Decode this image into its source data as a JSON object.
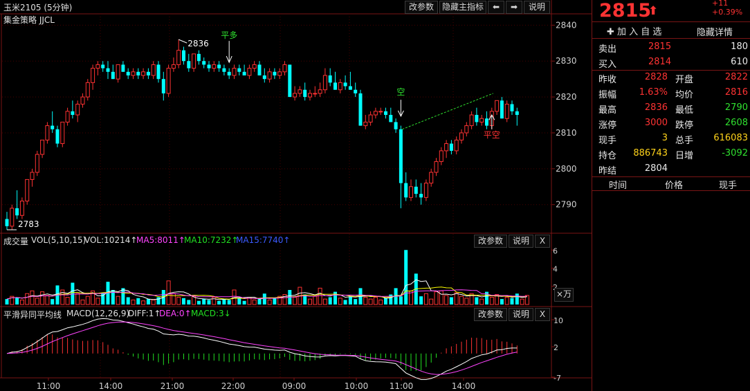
{
  "chart_title": "玉米2105 (5分钟)",
  "strategy_label": "集金策略 JJCL",
  "toolbar": {
    "params": "改参数",
    "hide_main": "隐藏主指标",
    "prev": "⬅",
    "next": "➡",
    "help": "说明"
  },
  "main": {
    "y_ticks": [
      2840,
      2830,
      2820,
      2810,
      2800,
      2790
    ],
    "max_label": "2836",
    "min_label": "2783",
    "annotation_pingduo": "平多",
    "annotation_kong": "空",
    "annotation_pingkong": "平空",
    "candles": [
      {
        "o": 2786,
        "h": 2788,
        "l": 2783,
        "c": 2784
      },
      {
        "o": 2784,
        "h": 2790,
        "l": 2783,
        "c": 2789
      },
      {
        "o": 2789,
        "h": 2794,
        "l": 2786,
        "c": 2787
      },
      {
        "o": 2787,
        "h": 2792,
        "l": 2786,
        "c": 2791
      },
      {
        "o": 2791,
        "h": 2797,
        "l": 2790,
        "c": 2797
      },
      {
        "o": 2797,
        "h": 2800,
        "l": 2795,
        "c": 2799
      },
      {
        "o": 2799,
        "h": 2805,
        "l": 2798,
        "c": 2804
      },
      {
        "o": 2804,
        "h": 2808,
        "l": 2803,
        "c": 2808
      },
      {
        "o": 2808,
        "h": 2813,
        "l": 2807,
        "c": 2812
      },
      {
        "o": 2812,
        "h": 2816,
        "l": 2810,
        "c": 2811
      },
      {
        "o": 2811,
        "h": 2812,
        "l": 2806,
        "c": 2807
      },
      {
        "o": 2807,
        "h": 2813,
        "l": 2806,
        "c": 2813
      },
      {
        "o": 2813,
        "h": 2817,
        "l": 2812,
        "c": 2816
      },
      {
        "o": 2816,
        "h": 2819,
        "l": 2814,
        "c": 2815
      },
      {
        "o": 2815,
        "h": 2819,
        "l": 2813,
        "c": 2818
      },
      {
        "o": 2818,
        "h": 2821,
        "l": 2817,
        "c": 2820
      },
      {
        "o": 2820,
        "h": 2825,
        "l": 2819,
        "c": 2824
      },
      {
        "o": 2824,
        "h": 2829,
        "l": 2822,
        "c": 2828
      },
      {
        "o": 2828,
        "h": 2830,
        "l": 2826,
        "c": 2829
      },
      {
        "o": 2829,
        "h": 2830,
        "l": 2827,
        "c": 2828
      },
      {
        "o": 2828,
        "h": 2830,
        "l": 2825,
        "c": 2827
      },
      {
        "o": 2827,
        "h": 2829,
        "l": 2825,
        "c": 2825
      },
      {
        "o": 2825,
        "h": 2829,
        "l": 2824,
        "c": 2829
      },
      {
        "o": 2829,
        "h": 2830,
        "l": 2827,
        "c": 2827
      },
      {
        "o": 2827,
        "h": 2828,
        "l": 2825,
        "c": 2826
      },
      {
        "o": 2826,
        "h": 2828,
        "l": 2825,
        "c": 2827
      },
      {
        "o": 2827,
        "h": 2828,
        "l": 2825,
        "c": 2826
      },
      {
        "o": 2826,
        "h": 2828,
        "l": 2825,
        "c": 2827
      },
      {
        "o": 2827,
        "h": 2828,
        "l": 2825,
        "c": 2826
      },
      {
        "o": 2826,
        "h": 2830,
        "l": 2825,
        "c": 2829
      },
      {
        "o": 2829,
        "h": 2830,
        "l": 2824,
        "c": 2825
      },
      {
        "o": 2825,
        "h": 2827,
        "l": 2819,
        "c": 2821
      },
      {
        "o": 2821,
        "h": 2829,
        "l": 2820,
        "c": 2828
      },
      {
        "o": 2828,
        "h": 2831,
        "l": 2827,
        "c": 2829
      },
      {
        "o": 2829,
        "h": 2836,
        "l": 2828,
        "c": 2833
      },
      {
        "o": 2833,
        "h": 2834,
        "l": 2829,
        "c": 2830
      },
      {
        "o": 2830,
        "h": 2832,
        "l": 2827,
        "c": 2828
      },
      {
        "o": 2828,
        "h": 2832,
        "l": 2827,
        "c": 2832
      },
      {
        "o": 2832,
        "h": 2833,
        "l": 2829,
        "c": 2830
      },
      {
        "o": 2830,
        "h": 2831,
        "l": 2828,
        "c": 2829
      },
      {
        "o": 2829,
        "h": 2830,
        "l": 2827,
        "c": 2828
      },
      {
        "o": 2828,
        "h": 2830,
        "l": 2827,
        "c": 2829
      },
      {
        "o": 2829,
        "h": 2830,
        "l": 2827,
        "c": 2828
      },
      {
        "o": 2828,
        "h": 2829,
        "l": 2826,
        "c": 2827
      },
      {
        "o": 2827,
        "h": 2828,
        "l": 2825,
        "c": 2826
      },
      {
        "o": 2826,
        "h": 2829,
        "l": 2825,
        "c": 2828
      },
      {
        "o": 2828,
        "h": 2829,
        "l": 2826,
        "c": 2827
      },
      {
        "o": 2827,
        "h": 2829,
        "l": 2826,
        "c": 2826
      },
      {
        "o": 2826,
        "h": 2829,
        "l": 2825,
        "c": 2828
      },
      {
        "o": 2828,
        "h": 2830,
        "l": 2827,
        "c": 2829
      },
      {
        "o": 2829,
        "h": 2830,
        "l": 2826,
        "c": 2826
      },
      {
        "o": 2826,
        "h": 2828,
        "l": 2824,
        "c": 2825
      },
      {
        "o": 2825,
        "h": 2828,
        "l": 2824,
        "c": 2827
      },
      {
        "o": 2827,
        "h": 2828,
        "l": 2825,
        "c": 2826
      },
      {
        "o": 2826,
        "h": 2828,
        "l": 2825,
        "c": 2827
      },
      {
        "o": 2827,
        "h": 2830,
        "l": 2826,
        "c": 2829
      },
      {
        "o": 2829,
        "h": 2829,
        "l": 2820,
        "c": 2820
      },
      {
        "o": 2820,
        "h": 2823,
        "l": 2819,
        "c": 2821
      },
      {
        "o": 2821,
        "h": 2823,
        "l": 2820,
        "c": 2822
      },
      {
        "o": 2822,
        "h": 2824,
        "l": 2819,
        "c": 2820
      },
      {
        "o": 2820,
        "h": 2822,
        "l": 2819,
        "c": 2821
      },
      {
        "o": 2821,
        "h": 2823,
        "l": 2820,
        "c": 2821
      },
      {
        "o": 2821,
        "h": 2824,
        "l": 2820,
        "c": 2822
      },
      {
        "o": 2822,
        "h": 2828,
        "l": 2821,
        "c": 2826
      },
      {
        "o": 2826,
        "h": 2828,
        "l": 2823,
        "c": 2824
      },
      {
        "o": 2824,
        "h": 2827,
        "l": 2822,
        "c": 2822
      },
      {
        "o": 2822,
        "h": 2825,
        "l": 2821,
        "c": 2824
      },
      {
        "o": 2824,
        "h": 2826,
        "l": 2822,
        "c": 2823
      },
      {
        "o": 2823,
        "h": 2827,
        "l": 2822,
        "c": 2822
      },
      {
        "o": 2822,
        "h": 2824,
        "l": 2820,
        "c": 2821
      },
      {
        "o": 2821,
        "h": 2822,
        "l": 2812,
        "c": 2812
      },
      {
        "o": 2812,
        "h": 2815,
        "l": 2811,
        "c": 2813
      },
      {
        "o": 2813,
        "h": 2816,
        "l": 2812,
        "c": 2815
      },
      {
        "o": 2815,
        "h": 2817,
        "l": 2814,
        "c": 2816
      },
      {
        "o": 2816,
        "h": 2817,
        "l": 2815,
        "c": 2816
      },
      {
        "o": 2816,
        "h": 2817,
        "l": 2814,
        "c": 2815
      },
      {
        "o": 2815,
        "h": 2817,
        "l": 2813,
        "c": 2813
      },
      {
        "o": 2813,
        "h": 2814,
        "l": 2810,
        "c": 2811
      },
      {
        "o": 2811,
        "h": 2812,
        "l": 2789,
        "c": 2796
      },
      {
        "o": 2796,
        "h": 2799,
        "l": 2791,
        "c": 2792
      },
      {
        "o": 2792,
        "h": 2797,
        "l": 2791,
        "c": 2795
      },
      {
        "o": 2795,
        "h": 2797,
        "l": 2792,
        "c": 2793
      },
      {
        "o": 2793,
        "h": 2796,
        "l": 2790,
        "c": 2792
      },
      {
        "o": 2792,
        "h": 2797,
        "l": 2791,
        "c": 2796
      },
      {
        "o": 2796,
        "h": 2800,
        "l": 2795,
        "c": 2799
      },
      {
        "o": 2799,
        "h": 2803,
        "l": 2798,
        "c": 2802
      },
      {
        "o": 2802,
        "h": 2806,
        "l": 2801,
        "c": 2805
      },
      {
        "o": 2805,
        "h": 2808,
        "l": 2803,
        "c": 2807
      },
      {
        "o": 2807,
        "h": 2808,
        "l": 2804,
        "c": 2805
      },
      {
        "o": 2805,
        "h": 2809,
        "l": 2804,
        "c": 2808
      },
      {
        "o": 2808,
        "h": 2811,
        "l": 2807,
        "c": 2810
      },
      {
        "o": 2810,
        "h": 2813,
        "l": 2809,
        "c": 2812
      },
      {
        "o": 2812,
        "h": 2816,
        "l": 2811,
        "c": 2815
      },
      {
        "o": 2815,
        "h": 2817,
        "l": 2812,
        "c": 2813
      },
      {
        "o": 2813,
        "h": 2815,
        "l": 2812,
        "c": 2814
      },
      {
        "o": 2814,
        "h": 2816,
        "l": 2811,
        "c": 2812
      },
      {
        "o": 2812,
        "h": 2817,
        "l": 2811,
        "c": 2816
      },
      {
        "o": 2816,
        "h": 2819,
        "l": 2815,
        "c": 2819
      },
      {
        "o": 2819,
        "h": 2820,
        "l": 2814,
        "c": 2814
      },
      {
        "o": 2814,
        "h": 2819,
        "l": 2813,
        "c": 2818
      },
      {
        "o": 2818,
        "h": 2819,
        "l": 2815,
        "c": 2816
      },
      {
        "o": 2816,
        "h": 2817,
        "l": 2812,
        "c": 2815
      }
    ]
  },
  "volume": {
    "title": "成交量",
    "vol_label": "VOL(5,10,15)",
    "vol_value": "VOL:10214↑",
    "ma5": "MA5:8011↑",
    "ma10": "MA10:7232↑",
    "ma15": "MA15:7740↑",
    "y_ticks": [
      "6",
      "4",
      "2"
    ],
    "unit": "×万",
    "values": [
      0.6,
      0.9,
      0.8,
      0.5,
      1.2,
      1.5,
      0.7,
      1.4,
      1.0,
      0.6,
      2.1,
      1.6,
      0.8,
      2.4,
      1.2,
      0.5,
      0.9,
      1.5,
      0.7,
      1.3,
      2.5,
      1.6,
      0.9,
      1.8,
      0.8,
      0.5,
      0.7,
      0.4,
      0.6,
      0.5,
      0.8,
      1.6,
      2.6,
      1.2,
      0.8,
      0.7,
      0.5,
      0.9,
      0.4,
      0.6,
      0.5,
      0.8,
      0.4,
      0.6,
      0.5,
      1.6,
      0.7,
      0.4,
      0.8,
      0.5,
      0.6,
      1.2,
      0.5,
      0.7,
      0.9,
      1.1,
      1.6,
      0.8,
      1.9,
      1.1,
      0.6,
      0.9,
      1.8,
      0.6,
      0.8,
      1.4,
      0.7,
      0.5,
      0.9,
      0.6,
      1.8,
      0.8,
      0.6,
      0.8,
      0.5,
      0.7,
      1.1,
      1.8,
      0.9,
      6.0,
      1.5,
      3.4,
      0.9,
      1.2,
      0.6,
      1.4,
      1.5,
      1.0,
      0.8,
      1.3,
      0.9,
      0.7,
      1.2,
      0.8,
      0.6,
      1.4,
      0.8,
      1.1,
      0.6,
      0.8,
      0.7,
      1.2,
      0.6,
      1.0
    ]
  },
  "macd": {
    "title": "平滑异同平均线",
    "label": "MACD(12,26,9)",
    "diff": "DIFF:1↑",
    "dea": "DEA:0↑",
    "macd_val": "MACD:3↓",
    "y_ticks": [
      "10",
      "2",
      "-7"
    ]
  },
  "time_labels": [
    "11:00",
    "14:00",
    "21:00",
    "22:00",
    "09:00",
    "10:00",
    "11:00",
    "14:00"
  ],
  "quote": {
    "price": "2815",
    "change": "+11",
    "change_pct": "+0.39%",
    "add_watch": "✚ 加 入 自 选",
    "hide_detail": "隐藏详情",
    "sell_label": "卖出",
    "sell_price": "2815",
    "sell_qty": "180",
    "buy_label": "买入",
    "buy_price": "2814",
    "buy_qty": "610",
    "rows": [
      {
        "l1": "昨收",
        "v1": "2828",
        "c1": "red",
        "l2": "开盘",
        "v2": "2822",
        "c2": "red"
      },
      {
        "l1": "振幅",
        "v1": "1.63%",
        "c1": "red",
        "l2": "均价",
        "v2": "2816",
        "c2": "red"
      },
      {
        "l1": "最高",
        "v1": "2836",
        "c1": "red",
        "l2": "最低",
        "v2": "2790",
        "c2": "green"
      },
      {
        "l1": "涨停",
        "v1": "3000",
        "c1": "red",
        "l2": "跌停",
        "v2": "2608",
        "c2": "green"
      },
      {
        "l1": "现手",
        "v1": "3",
        "c1": "yellow",
        "l2": "总手",
        "v2": "616083",
        "c2": "yellow"
      },
      {
        "l1": "持仓",
        "v1": "886743",
        "c1": "yellow",
        "l2": "日增",
        "v2": "-3092",
        "c2": "green"
      },
      {
        "l1": "昨结",
        "v1": "2804",
        "c1": "white",
        "l2": "",
        "v2": "",
        "c2": "white"
      }
    ],
    "tick_headers": [
      "时间",
      "价格",
      "现手"
    ]
  },
  "colors": {
    "up": "#ff3232",
    "down": "#00ffff",
    "grid": "#4a0000",
    "border": "#7a1515",
    "ma5": "#ffffff",
    "ma10": "#ffff00",
    "ma15": "#ff00ff"
  }
}
